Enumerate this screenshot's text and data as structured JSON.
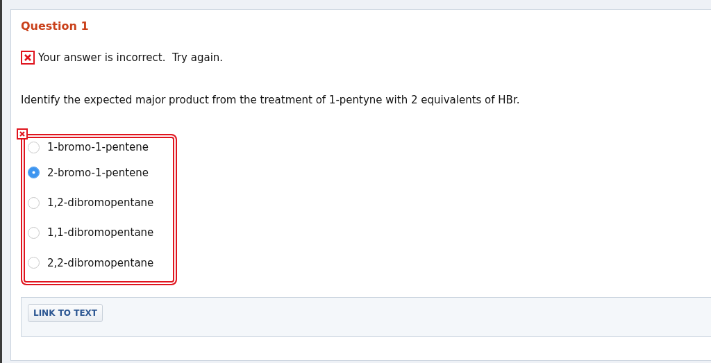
{
  "question": {
    "title": "Question 1",
    "feedback": {
      "kind": "incorrect",
      "text": "Your answer is incorrect.  Try again."
    },
    "prompt": "Identify the expected major product from the treatment of 1-pentyne with 2 equivalents of HBr.",
    "choices_marked_incorrect": true,
    "choices": [
      {
        "label": "1-bromo-1-pentene",
        "selected": false
      },
      {
        "label": "2-bromo-1-pentene",
        "selected": true
      },
      {
        "label": "1,2-dibromopentane",
        "selected": false
      },
      {
        "label": "1,1-dibromopentane",
        "selected": false
      },
      {
        "label": "2,2-dibromopentane",
        "selected": false
      }
    ]
  },
  "footer": {
    "buttons": [
      "LINK TO TEXT"
    ]
  }
}
